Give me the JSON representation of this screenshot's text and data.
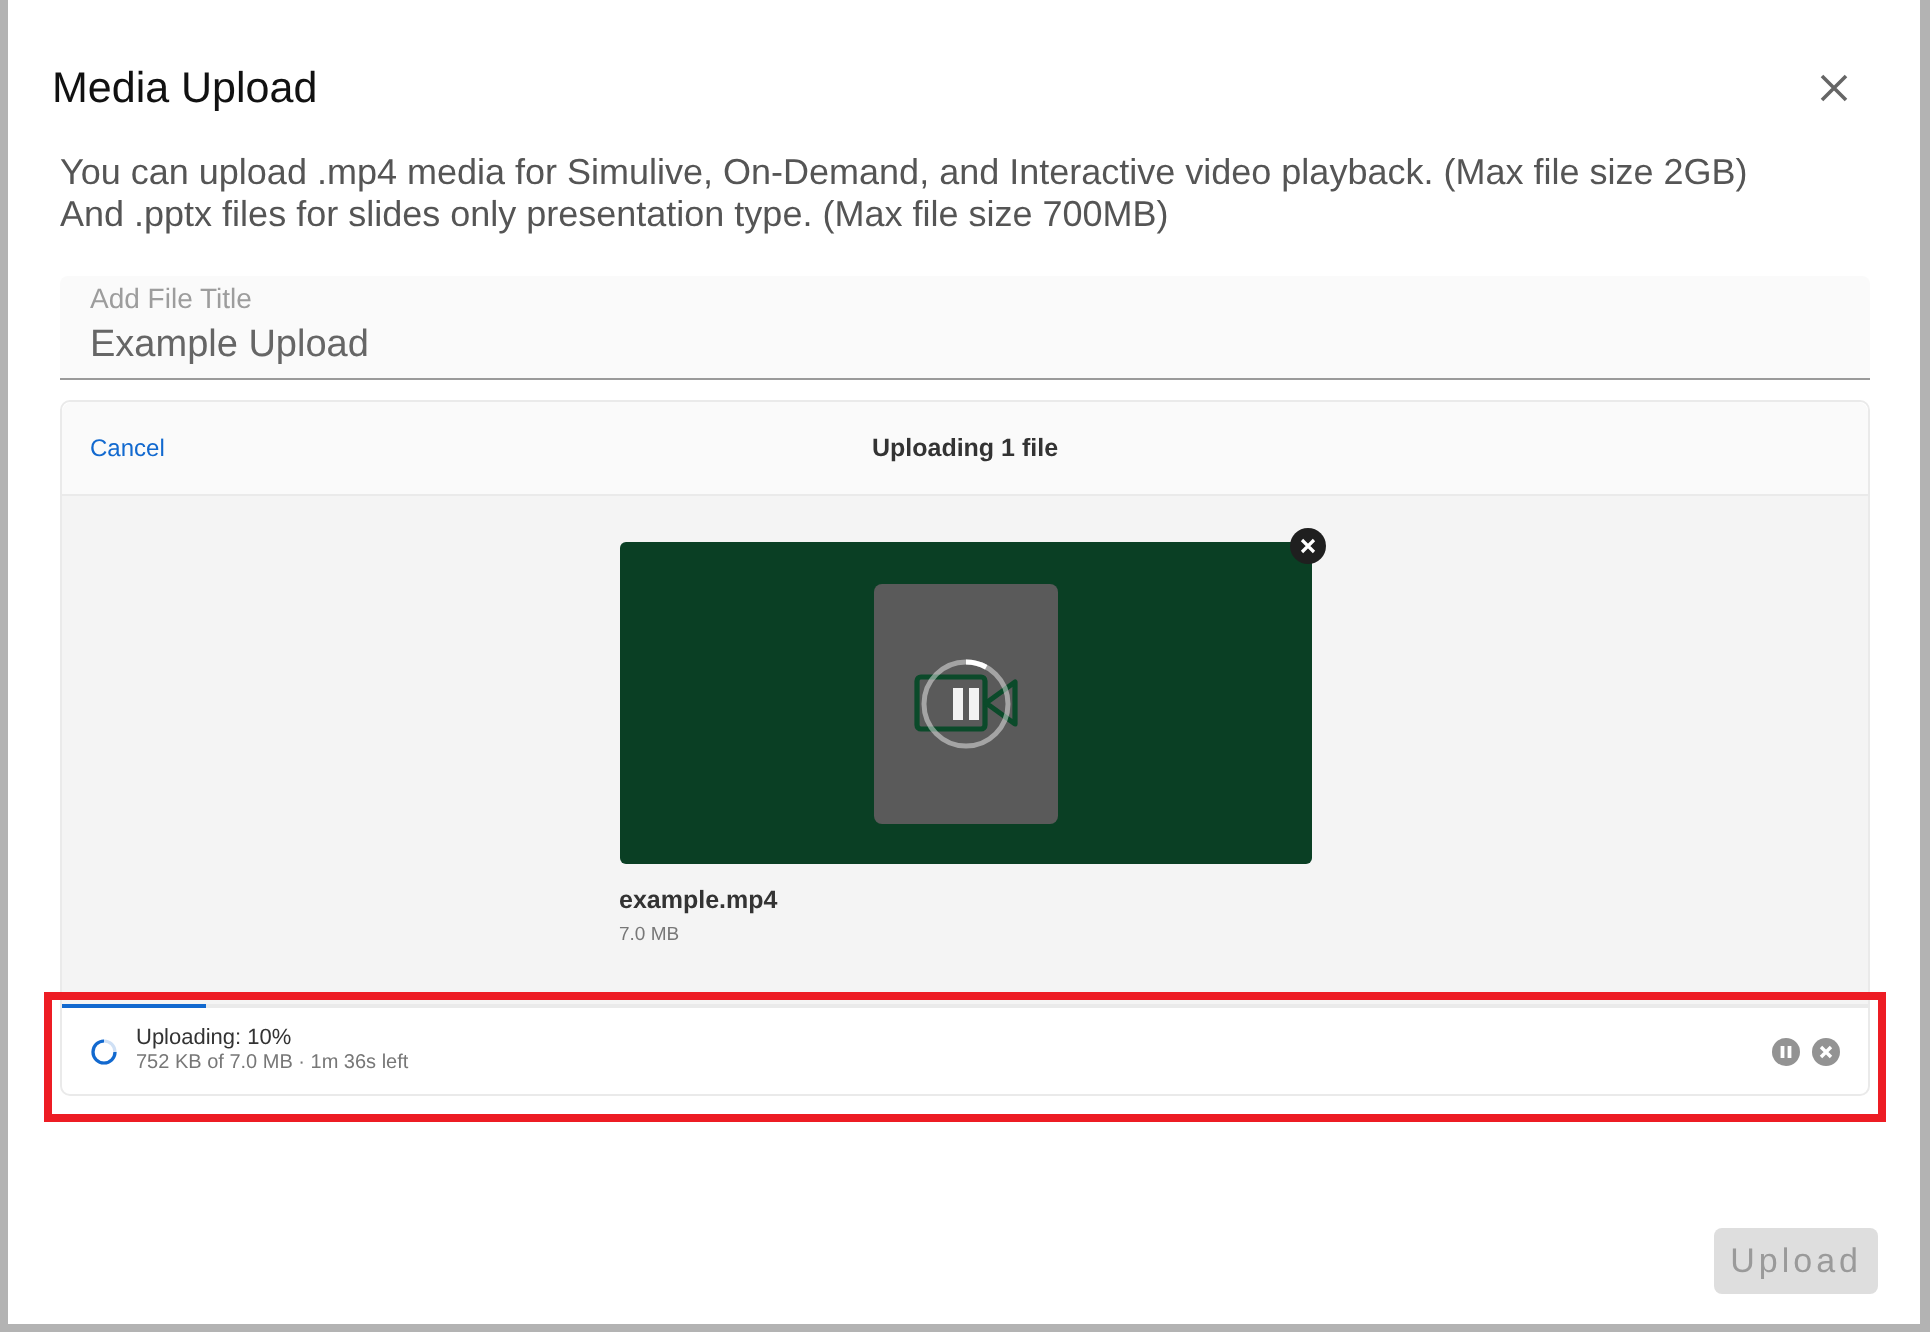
{
  "modal": {
    "title": "Media Upload"
  },
  "description": [
    "You can upload .mp4 media for Simulive, On-Demand, and Interactive video playback. (Max file size 2GB)",
    "And .pptx files for slides only presentation type. (Max file size 700MB)"
  ],
  "title_field": {
    "label": "Add File Title",
    "value": "Example Upload"
  },
  "dashboard": {
    "cancel": "Cancel",
    "heading": "Uploading 1 file",
    "files": [
      {
        "kind": "video",
        "name": "example.mp4",
        "size": "7.0 MB"
      }
    ]
  },
  "upload_status": {
    "highlighted": true,
    "title": "Uploading: 10%",
    "detail": "752 KB of 7.0 MB · 1m 36s left",
    "level": 0.08
  },
  "upload_button": {
    "label": "Upload",
    "disabled": true
  }
}
